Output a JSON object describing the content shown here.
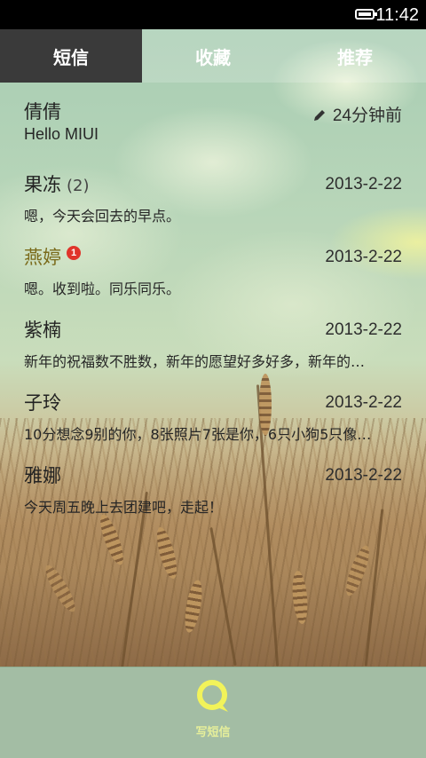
{
  "status_bar": {
    "time": "11:42"
  },
  "tabs": [
    {
      "label": "短信"
    },
    {
      "label": "收藏"
    },
    {
      "label": "推荐"
    }
  ],
  "threads": [
    {
      "name": "倩倩",
      "count": "",
      "time": "24分钟前",
      "preview": "Hello MIUI"
    },
    {
      "name": "果冻",
      "count": "(2)",
      "time": "2013-2-22",
      "preview": "嗯，今天会回去的早点。"
    },
    {
      "name": "燕婷",
      "count": "",
      "badge": "1",
      "time": "2013-2-22",
      "preview": "嗯。收到啦。同乐同乐。"
    },
    {
      "name": "紫楠",
      "count": "",
      "time": "2013-2-22",
      "preview": "新年的祝福数不胜数，新年的愿望好多好多，新年的…"
    },
    {
      "name": "子玲",
      "count": "",
      "time": "2013-2-22",
      "preview": "10分想念9别的你，8张照片7张是你，6只小狗5只像…"
    },
    {
      "name": "雅娜",
      "count": "",
      "time": "2013-2-22",
      "preview": "今天周五晚上去团建吧，走起！"
    }
  ],
  "bottom_bar": {
    "compose_label": "写短信"
  },
  "colors": {
    "active_tab": "#3a3a3a",
    "badge": "#e0342a",
    "compose_icon": "#f2f35a"
  }
}
